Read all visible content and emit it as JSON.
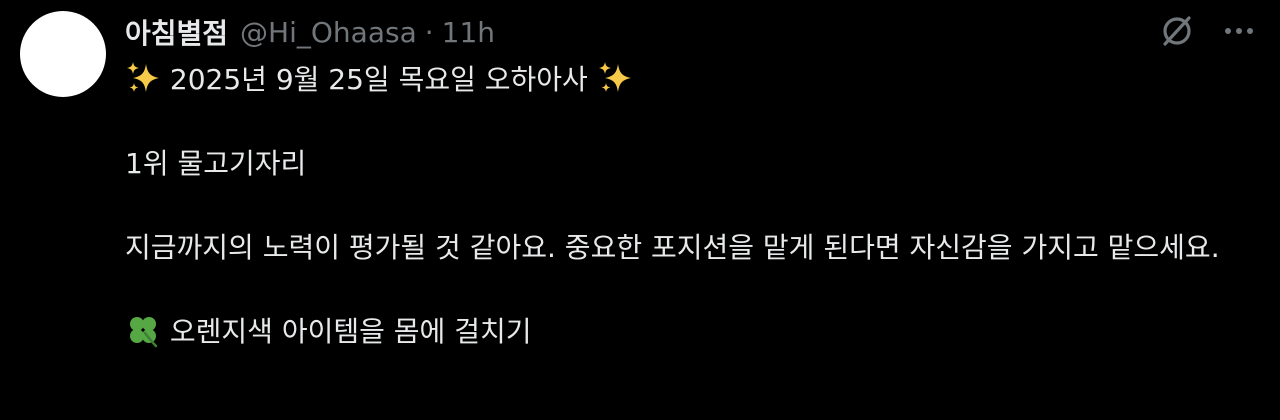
{
  "author": {
    "display_name": "아침별점",
    "handle": "@Hi_Ohaasa",
    "separator": "·",
    "time": "11h"
  },
  "actions": {
    "grok_icon": "slashed-circle-icon",
    "more_icon": "more-dots-icon"
  },
  "tweet": {
    "line1": "2025년 9월 25일 목요일 오하아사",
    "line1_lead_emoji": "sparkles",
    "line1_trail_emoji": "sparkles",
    "line2": "1위 물고기자리",
    "line3": "지금까지의 노력이 평가될 것 같아요. 중요한 포지션을 맡게 된다면 자신감을 가지고 맡으세요.",
    "line4": "오렌지색 아이템을 몸에 걸치기",
    "line4_lead_emoji": "four-leaf-clover"
  },
  "colors": {
    "background": "#000000",
    "text": "#e7e9ea",
    "muted": "#71767b",
    "sparkle": "#f7c948",
    "clover": "#56a845"
  }
}
